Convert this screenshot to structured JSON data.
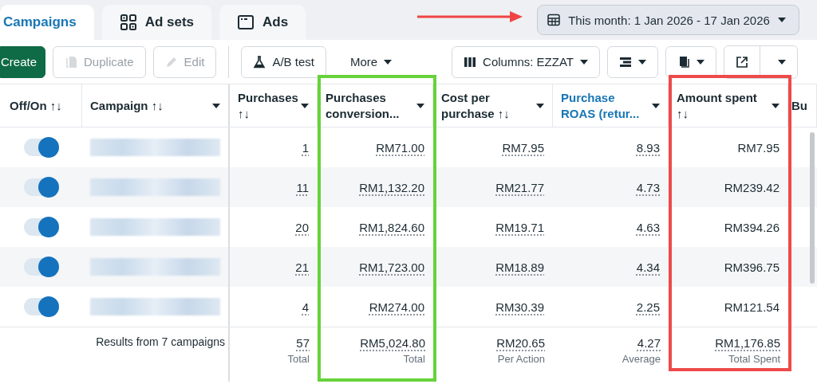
{
  "tabs": [
    {
      "label": "Campaigns",
      "selected": true
    },
    {
      "label": "Ad sets",
      "selected": false
    },
    {
      "label": "Ads",
      "selected": false
    }
  ],
  "date_range": {
    "label": "This month: 1 Jan 2026 - 17 Jan 2026"
  },
  "toolbar": [
    {
      "kind": "primary",
      "label": "Create",
      "disabled": false
    },
    {
      "kind": "duplicate",
      "label": "Duplicate",
      "disabled": true
    },
    {
      "kind": "edit",
      "label": "Edit",
      "disabled": true
    },
    {
      "kind": "divider"
    },
    {
      "kind": "abtest",
      "label": "A/B test",
      "disabled": false
    },
    {
      "kind": "more",
      "label": "More",
      "disabled": false
    },
    {
      "kind": "spacer"
    },
    {
      "kind": "columns",
      "label": "Columns: EZZAT",
      "disabled": false
    },
    {
      "kind": "breakdown",
      "disabled": false
    },
    {
      "kind": "reports",
      "disabled": false
    },
    {
      "kind": "export",
      "disabled": false
    }
  ],
  "table": {
    "columns": [
      {
        "label": "Off/On ↑↓",
        "menu": false,
        "active": false
      },
      {
        "label": "Campaign ↑↓",
        "menu": true,
        "active": false
      },
      {
        "label": "Purchases ↑↓",
        "menu": true,
        "active": false
      },
      {
        "label": "Purchases conversion...",
        "menu": true,
        "active": false,
        "color": "#66d33a"
      },
      {
        "label": "Cost per purchase ↑↓",
        "menu": true,
        "active": false
      },
      {
        "label": "Purchase ROAS (retur...",
        "menu": true,
        "active": true
      },
      {
        "label": "Amount spent ↑↓",
        "menu": true,
        "active": false,
        "color": "#ef4a4a"
      },
      {
        "label": "Bu",
        "menu": false,
        "active": false
      }
    ],
    "rows": [
      {
        "on": true,
        "values": [
          "1",
          "RM71.00",
          "RM7.95",
          "8.93",
          "RM7.95"
        ]
      },
      {
        "on": true,
        "values": [
          "11",
          "RM1,132.20",
          "RM21.77",
          "4.73",
          "RM239.42"
        ]
      },
      {
        "on": true,
        "values": [
          "20",
          "RM1,824.60",
          "RM19.71",
          "4.63",
          "RM394.26"
        ]
      },
      {
        "on": true,
        "values": [
          "21",
          "RM1,723.00",
          "RM18.89",
          "4.34",
          "RM396.75"
        ]
      },
      {
        "on": true,
        "values": [
          "4",
          "RM274.00",
          "RM30.39",
          "2.25",
          "RM121.54"
        ]
      }
    ],
    "summary": {
      "label": "Results from 7 campaigns",
      "values": [
        {
          "value": "57",
          "caption": "Total"
        },
        {
          "value": "RM5,024.80",
          "caption": "Total"
        },
        {
          "value": "RM20.65",
          "caption": "Per Action"
        },
        {
          "value": "4.27",
          "caption": "Average"
        },
        {
          "value": "RM1,176.85",
          "caption": "Total Spent"
        }
      ]
    }
  },
  "annotations": {
    "arrow": {
      "color": "#ef4444"
    }
  }
}
